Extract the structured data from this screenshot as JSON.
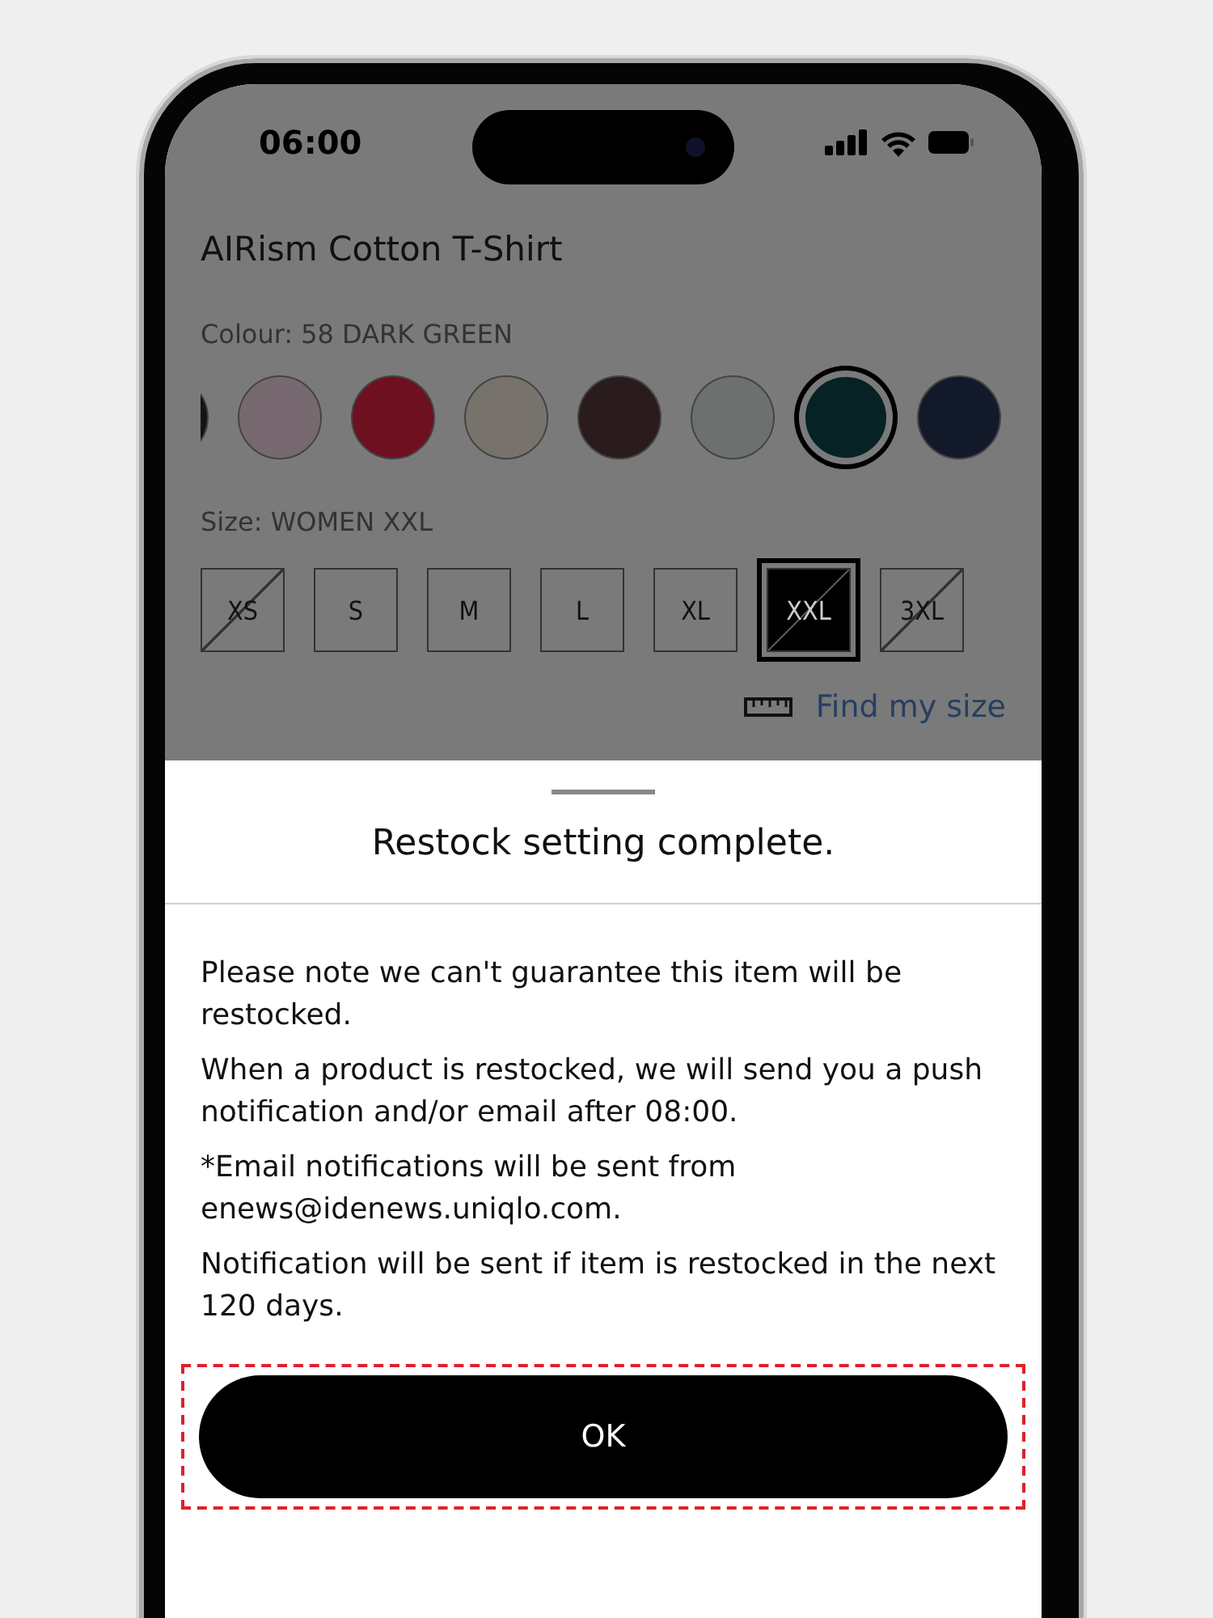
{
  "status_bar": {
    "time": "06:00"
  },
  "product": {
    "title": "AIRism Cotton T-Shirt",
    "colour_label": "Colour: 58 DARK GREEN",
    "swatches": [
      {
        "color": "#141414",
        "selected": false
      },
      {
        "color": "#786870",
        "selected": false
      },
      {
        "color": "#6e1020",
        "selected": false
      },
      {
        "color": "#77736c",
        "selected": false
      },
      {
        "color": "#2a1c1c",
        "selected": false
      },
      {
        "color": "#6c706f",
        "selected": false
      },
      {
        "color": "#062224",
        "selected": true
      },
      {
        "color": "#121a2a",
        "selected": false
      }
    ],
    "size_label": "Size: WOMEN XXL",
    "sizes": [
      {
        "label": "XS",
        "available": false,
        "selected": false
      },
      {
        "label": "S",
        "available": true,
        "selected": false
      },
      {
        "label": "M",
        "available": true,
        "selected": false
      },
      {
        "label": "L",
        "available": true,
        "selected": false
      },
      {
        "label": "XL",
        "available": true,
        "selected": false
      },
      {
        "label": "XXL",
        "available": false,
        "selected": true
      },
      {
        "label": "3XL",
        "available": false,
        "selected": false
      }
    ],
    "size_link": "Find my size"
  },
  "sheet": {
    "title": "Restock setting complete.",
    "paragraphs": [
      "Please note we can't guarantee this item will be restocked.",
      "When a product is restocked, we will send you a push notification and/or email after 08:00.",
      "*Email notifications will be sent from enews@idenews.uniqlo.com.",
      "Notification will be sent if item is restocked in the next 120 days."
    ],
    "button": {
      "label": "OK",
      "highlighted": true
    }
  }
}
